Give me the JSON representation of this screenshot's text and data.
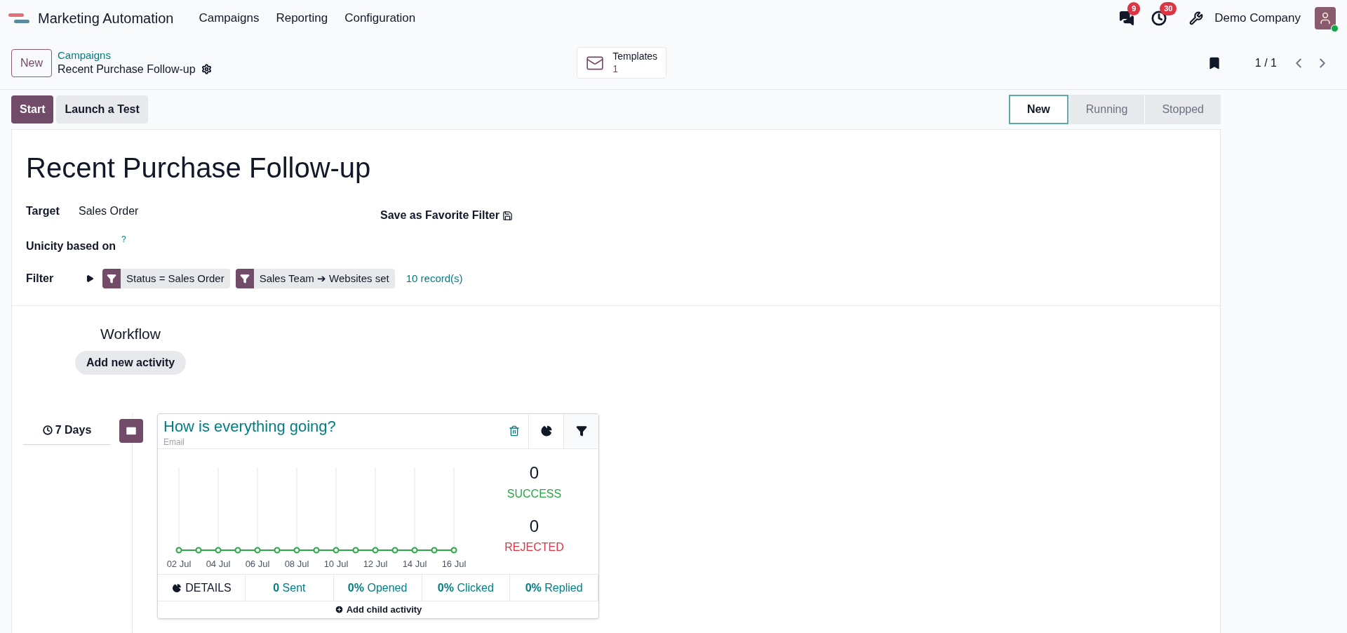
{
  "navbar": {
    "app_name": "Marketing Automation",
    "menu": [
      "Campaigns",
      "Reporting",
      "Configuration"
    ],
    "messages_count": "9",
    "activities_count": "30",
    "company": "Demo Company"
  },
  "control_panel": {
    "new_button": "New",
    "breadcrumb": "Campaigns",
    "record_name": "Recent Purchase Follow-up",
    "templates_label": "Templates",
    "templates_count": "1",
    "pager": "1 / 1"
  },
  "actions": [
    {
      "label": "Start",
      "kind": "primary"
    },
    {
      "label": "Launch a Test",
      "kind": "secondary"
    }
  ],
  "stages": [
    {
      "label": "New",
      "selected": true
    },
    {
      "label": "Running",
      "selected": false
    },
    {
      "label": "Stopped",
      "selected": false
    }
  ],
  "form": {
    "title": "Recent Purchase Follow-up",
    "target_label": "Target",
    "target_value": "Sales Order",
    "save_filter": "Save as Favorite Filter",
    "unicity_label": "Unicity based on",
    "unicity_help": "?",
    "filter_label": "Filter",
    "filters": [
      "Status = Sales Order",
      "Sales Team ➔ Websites set"
    ],
    "records": "10 record(s)"
  },
  "workflow": {
    "title": "Workflow",
    "add_button": "Add new activity",
    "activity": {
      "delay": "7 Days",
      "name": "How is everything going?",
      "type": "Email",
      "x_labels": [
        "02 Jul",
        "04 Jul",
        "06 Jul",
        "08 Jul",
        "10 Jul",
        "12 Jul",
        "14 Jul",
        "16 Jul"
      ],
      "success_count": "0",
      "success_label": "SUCCESS",
      "rejected_count": "0",
      "rejected_label": "REJECTED",
      "details": "DETAILS",
      "stats": [
        {
          "value": "0",
          "label": "Sent"
        },
        {
          "value": "0%",
          "label": "Opened"
        },
        {
          "value": "0%",
          "label": "Clicked"
        },
        {
          "value": "0%",
          "label": "Replied"
        }
      ],
      "add_child": "Add child activity"
    }
  }
}
